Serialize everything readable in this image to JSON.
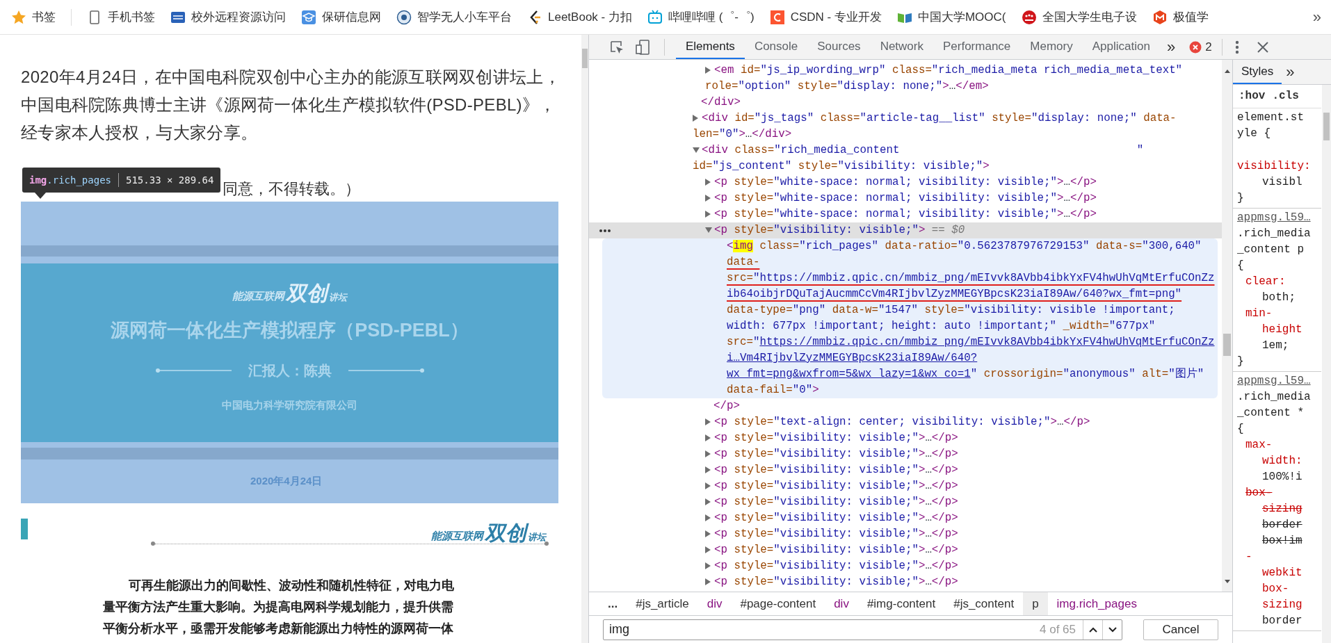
{
  "bookmarks": [
    {
      "kind": "star",
      "label": "书签"
    },
    {
      "kind": "phone",
      "label": "手机书签"
    },
    {
      "kind": "square",
      "label": "校外远程资源访问"
    },
    {
      "kind": "cap",
      "label": "保研信息网"
    },
    {
      "kind": "emblem",
      "label": "智学无人小车平台"
    },
    {
      "kind": "chevron",
      "label": "LeetBook - 力扣"
    },
    {
      "kind": "tv",
      "label": "哔哩哔哩 (゜-゜)"
    },
    {
      "kind": "c",
      "label": "CSDN - 专业开发"
    },
    {
      "kind": "book",
      "label": "中国大学MOOC("
    },
    {
      "kind": "people",
      "label": "全国大学生电子设"
    },
    {
      "kind": "hexagon",
      "label": "极值学"
    }
  ],
  "bookmarks_more": "»",
  "article": {
    "intro": "2020年4月24日，在中国电科院双创中心主办的能源互联网双创讲坛上，中国电科院陈典博士主讲《源网荷一体化生产模拟软件(PSD-PEBL)》，经专家本人授权，与大家分享。",
    "note": "同意，不得转载。）",
    "tooltip": {
      "tag": "img",
      "class": ".rich_pages",
      "size": "515.33 × 289.64"
    },
    "slide": {
      "logo": {
        "left": "能源互联网",
        "big": "双创",
        "right": "讲坛"
      },
      "title": "源网荷一体化生产模拟程序（PSD-PEBL）",
      "presenter": "汇报人：陈典",
      "org": "中国电力科学研究院有限公司",
      "date": "2020年4月24日"
    },
    "section_logo": {
      "left": "能源互联网",
      "big": "双创",
      "right": "讲坛"
    },
    "body": "可再生能源出力的间歇性、波动性和随机性特征，对电力电量平衡方法产生重大影响。为提高电网科学规划能力，提升供需平衡分析水平，亟需开发能够考虑新能源出力特性的源网荷一体"
  },
  "devtools": {
    "tabs": [
      {
        "label": "Elements",
        "selected": true
      },
      {
        "label": "Console",
        "selected": false
      },
      {
        "label": "Sources",
        "selected": false
      },
      {
        "label": "Network",
        "selected": false
      },
      {
        "label": "Performance",
        "selected": false
      },
      {
        "label": "Memory",
        "selected": false
      },
      {
        "label": "Application",
        "selected": false
      }
    ],
    "tabs_more": "»",
    "errors": "2",
    "tree": [
      {
        "children": [
          {
            "expanded": false,
            "selected": false,
            "hovered": false,
            "tokens": [
              {
                "kind": "tag",
                "text": "<em"
              },
              {
                "kind": "attr",
                "text": " id="
              },
              {
                "kind": "value",
                "text": "\"js_ip_wording_wrp\""
              },
              {
                "kind": "attr",
                "text": " class="
              },
              {
                "kind": "value",
                "text": "\"rich_media_meta rich_media_meta_text\""
              },
              {
                "kind": "attr",
                "text": " role="
              },
              {
                "kind": "value",
                "text": "\"option\""
              },
              {
                "kind": "attr",
                "text": " style="
              },
              {
                "kind": "value",
                "text": "\"display: none;\""
              },
              {
                "kind": "tag",
                "text": ">"
              },
              {
                "kind": "text",
                "text": "…"
              },
              {
                "kind": "tag",
                "text": "</em>"
              }
            ]
          }
        ],
        "close": [
          {
            "kind": "tag",
            "text": "</div>"
          }
        ]
      },
      {
        "expanded": false,
        "selected": false,
        "hovered": false,
        "tokens": [
          {
            "kind": "tag",
            "text": "<div"
          },
          {
            "kind": "attr",
            "text": " id="
          },
          {
            "kind": "value",
            "text": "\"js_tags\""
          },
          {
            "kind": "attr",
            "text": " class="
          },
          {
            "kind": "value",
            "text": "\"article-tag__list\""
          },
          {
            "kind": "attr",
            "text": " style="
          },
          {
            "kind": "value",
            "text": "\"display: none;\""
          },
          {
            "kind": "attr",
            "text": " data-len="
          },
          {
            "kind": "value",
            "text": "\"0\""
          },
          {
            "kind": "tag",
            "text": ">"
          },
          {
            "kind": "text",
            "text": "…"
          },
          {
            "kind": "tag",
            "text": "</div>"
          }
        ]
      },
      {
        "expanded": true,
        "selected": false,
        "hovered": false,
        "tokens": [
          {
            "kind": "tag",
            "text": "<div"
          },
          {
            "kind": "attr",
            "text": " class="
          },
          {
            "kind": "value",
            "text": "\"rich_media_content                                    \""
          },
          {
            "kind": "attr",
            "text": " id="
          },
          {
            "kind": "value",
            "text": "\"js_content\""
          },
          {
            "kind": "attr",
            "text": " style="
          },
          {
            "kind": "value",
            "text": "\"visibility: visible;\""
          },
          {
            "kind": "tag",
            "text": ">"
          }
        ],
        "children": [
          {
            "expanded": false,
            "selected": false,
            "hovered": false,
            "tokens": [
              {
                "kind": "tag",
                "text": "<p"
              },
              {
                "kind": "attr",
                "text": " style="
              },
              {
                "kind": "value",
                "text": "\"white-space: normal; visibility: visible;\""
              },
              {
                "kind": "tag",
                "text": ">"
              },
              {
                "kind": "text",
                "text": "…"
              },
              {
                "kind": "tag",
                "text": "</p>"
              }
            ]
          },
          {
            "expanded": false,
            "selected": false,
            "hovered": false,
            "tokens": [
              {
                "kind": "tag",
                "text": "<p"
              },
              {
                "kind": "attr",
                "text": " style="
              },
              {
                "kind": "value",
                "text": "\"white-space: normal; visibility: visible;\""
              },
              {
                "kind": "tag",
                "text": ">"
              },
              {
                "kind": "text",
                "text": "…"
              },
              {
                "kind": "tag",
                "text": "</p>"
              }
            ]
          },
          {
            "expanded": false,
            "selected": false,
            "hovered": false,
            "tokens": [
              {
                "kind": "tag",
                "text": "<p"
              },
              {
                "kind": "attr",
                "text": " style="
              },
              {
                "kind": "value",
                "text": "\"white-space: normal; visibility: visible;\""
              },
              {
                "kind": "tag",
                "text": ">"
              },
              {
                "kind": "text",
                "text": "…"
              },
              {
                "kind": "tag",
                "text": "</p>"
              }
            ]
          },
          {
            "expanded": true,
            "selected": true,
            "hovered": false,
            "tokens": [
              {
                "kind": "tag",
                "text": "<p"
              },
              {
                "kind": "attr",
                "text": " style="
              },
              {
                "kind": "value",
                "text": "\"visibility: visible;\""
              },
              {
                "kind": "tag",
                "text": ">"
              },
              {
                "kind": "ref",
                "text": " == $0"
              }
            ],
            "children": [
              {
                "selected": false,
                "hovered": true,
                "tokens": [
                  {
                    "kind": "tag",
                    "text": "<"
                  },
                  {
                    "kind": "tag",
                    "text": "img",
                    "search_match": true
                  },
                  {
                    "kind": "attr",
                    "text": " class="
                  },
                  {
                    "kind": "value",
                    "text": "\"rich_pages\""
                  },
                  {
                    "kind": "attr",
                    "text": " data-ratio="
                  },
                  {
                    "kind": "value",
                    "text": "\"0.5623787976729153\""
                  },
                  {
                    "kind": "attr",
                    "text": " data-s="
                  },
                  {
                    "kind": "value",
                    "text": "\"300,640\" "
                  },
                  {
                    "kind": "attr",
                    "text": "data-src=",
                    "red_underline": true
                  },
                  {
                    "kind": "value",
                    "text": "\"https://mmbiz.qpic.cn/mmbiz_png/mEIvvk8AVbb4ibkYxFV4hwUhVqMtErfuCOnZzib64oibjrDQuTajAucmmCcVm4RIjbvlZyzMMEGYBpcsK23iaI89Aw/640?wx_fmt=png\"",
                    "red_underline": true
                  },
                  {
                    "kind": "attr",
                    "text": " data-type="
                  },
                  {
                    "kind": "value",
                    "text": "\"png\""
                  },
                  {
                    "kind": "attr",
                    "text": " data-w="
                  },
                  {
                    "kind": "value",
                    "text": "\"1547\""
                  },
                  {
                    "kind": "attr",
                    "text": " style="
                  },
                  {
                    "kind": "value",
                    "text": "\"visibility: visible !important; width: 677px !important; height: auto !important;\""
                  },
                  {
                    "kind": "attr",
                    "text": " _width="
                  },
                  {
                    "kind": "value",
                    "text": "\"677px\""
                  },
                  {
                    "kind": "attr",
                    "text": " src="
                  },
                  {
                    "kind": "value",
                    "text": "\""
                  },
                  {
                    "kind": "link",
                    "text": "https://mmbiz.qpic.cn/mmbiz_png/mEIvvk8AVbb4ibkYxFV4hwUhVqMtErfuCOnZzi…Vm4RIjbvlZyzMMEGYBpcsK23iaI89Aw/640?wx_fmt=png&wxfrom=5&wx_lazy=1&wx_co=1"
                  },
                  {
                    "kind": "value",
                    "text": "\""
                  },
                  {
                    "kind": "attr",
                    "text": " crossorigin="
                  },
                  {
                    "kind": "value",
                    "text": "\"anonymous\""
                  },
                  {
                    "kind": "attr",
                    "text": " alt="
                  },
                  {
                    "kind": "value",
                    "text": "\"图片\""
                  },
                  {
                    "kind": "attr",
                    "text": " data-fail="
                  },
                  {
                    "kind": "value",
                    "text": "\"0\""
                  },
                  {
                    "kind": "tag",
                    "text": ">"
                  }
                ]
              }
            ],
            "close": [
              {
                "kind": "tag",
                "text": "</p>"
              }
            ]
          },
          {
            "expanded": false,
            "selected": false,
            "hovered": false,
            "tokens": [
              {
                "kind": "tag",
                "text": "<p"
              },
              {
                "kind": "attr",
                "text": " style="
              },
              {
                "kind": "value",
                "text": "\"text-align: center; visibility: visible;\""
              },
              {
                "kind": "tag",
                "text": ">"
              },
              {
                "kind": "text",
                "text": "…"
              },
              {
                "kind": "tag",
                "text": "</p>"
              }
            ]
          },
          {
            "expanded": false,
            "selected": false,
            "hovered": false,
            "tokens": [
              {
                "kind": "tag",
                "text": "<p"
              },
              {
                "kind": "attr",
                "text": " style="
              },
              {
                "kind": "value",
                "text": "\"visibility: visible;\""
              },
              {
                "kind": "tag",
                "text": ">"
              },
              {
                "kind": "text",
                "text": "…"
              },
              {
                "kind": "tag",
                "text": "</p>"
              }
            ]
          },
          {
            "expanded": false,
            "selected": false,
            "hovered": false,
            "tokens": [
              {
                "kind": "tag",
                "text": "<p"
              },
              {
                "kind": "attr",
                "text": " style="
              },
              {
                "kind": "value",
                "text": "\"visibility: visible;\""
              },
              {
                "kind": "tag",
                "text": ">"
              },
              {
                "kind": "text",
                "text": "…"
              },
              {
                "kind": "tag",
                "text": "</p>"
              }
            ]
          },
          {
            "expanded": false,
            "selected": false,
            "hovered": false,
            "tokens": [
              {
                "kind": "tag",
                "text": "<p"
              },
              {
                "kind": "attr",
                "text": " style="
              },
              {
                "kind": "value",
                "text": "\"visibility: visible;\""
              },
              {
                "kind": "tag",
                "text": ">"
              },
              {
                "kind": "text",
                "text": "…"
              },
              {
                "kind": "tag",
                "text": "</p>"
              }
            ]
          },
          {
            "expanded": false,
            "selected": false,
            "hovered": false,
            "tokens": [
              {
                "kind": "tag",
                "text": "<p"
              },
              {
                "kind": "attr",
                "text": " style="
              },
              {
                "kind": "value",
                "text": "\"visibility: visible;\""
              },
              {
                "kind": "tag",
                "text": ">"
              },
              {
                "kind": "text",
                "text": "…"
              },
              {
                "kind": "tag",
                "text": "</p>"
              }
            ]
          },
          {
            "expanded": false,
            "selected": false,
            "hovered": false,
            "tokens": [
              {
                "kind": "tag",
                "text": "<p"
              },
              {
                "kind": "attr",
                "text": " style="
              },
              {
                "kind": "value",
                "text": "\"visibility: visible;\""
              },
              {
                "kind": "tag",
                "text": ">"
              },
              {
                "kind": "text",
                "text": "…"
              },
              {
                "kind": "tag",
                "text": "</p>"
              }
            ]
          },
          {
            "expanded": false,
            "selected": false,
            "hovered": false,
            "tokens": [
              {
                "kind": "tag",
                "text": "<p"
              },
              {
                "kind": "attr",
                "text": " style="
              },
              {
                "kind": "value",
                "text": "\"visibility: visible;\""
              },
              {
                "kind": "tag",
                "text": ">"
              },
              {
                "kind": "text",
                "text": "…"
              },
              {
                "kind": "tag",
                "text": "</p>"
              }
            ]
          },
          {
            "expanded": false,
            "selected": false,
            "hovered": false,
            "tokens": [
              {
                "kind": "tag",
                "text": "<p"
              },
              {
                "kind": "attr",
                "text": " style="
              },
              {
                "kind": "value",
                "text": "\"visibility: visible;\""
              },
              {
                "kind": "tag",
                "text": ">"
              },
              {
                "kind": "text",
                "text": "…"
              },
              {
                "kind": "tag",
                "text": "</p>"
              }
            ]
          },
          {
            "expanded": false,
            "selected": false,
            "hovered": false,
            "tokens": [
              {
                "kind": "tag",
                "text": "<p"
              },
              {
                "kind": "attr",
                "text": " style="
              },
              {
                "kind": "value",
                "text": "\"visibility: visible;\""
              },
              {
                "kind": "tag",
                "text": ">"
              },
              {
                "kind": "text",
                "text": "…"
              },
              {
                "kind": "tag",
                "text": "</p>"
              }
            ]
          },
          {
            "expanded": false,
            "selected": false,
            "hovered": false,
            "tokens": [
              {
                "kind": "tag",
                "text": "<p"
              },
              {
                "kind": "attr",
                "text": " style="
              },
              {
                "kind": "value",
                "text": "\"visibility: visible;\""
              },
              {
                "kind": "tag",
                "text": ">"
              },
              {
                "kind": "text",
                "text": "…"
              },
              {
                "kind": "tag",
                "text": "</p>"
              }
            ]
          },
          {
            "expanded": false,
            "selected": false,
            "hovered": false,
            "tokens": [
              {
                "kind": "tag",
                "text": "<p"
              },
              {
                "kind": "attr",
                "text": " style="
              },
              {
                "kind": "value",
                "text": "\"visibility: visible;\""
              },
              {
                "kind": "tag",
                "text": ">"
              },
              {
                "kind": "text",
                "text": "…"
              },
              {
                "kind": "tag",
                "text": "</p>"
              }
            ]
          }
        ]
      }
    ],
    "breadcrumb": [
      {
        "kind": "more",
        "text": "...",
        "selected": false
      },
      {
        "kind": "id",
        "text": "#js_article",
        "selected": false
      },
      {
        "kind": "tag",
        "text": "div",
        "selected": false
      },
      {
        "kind": "id",
        "text": "#page-content",
        "selected": false
      },
      {
        "kind": "tag",
        "text": "div",
        "selected": false
      },
      {
        "kind": "id",
        "text": "#img-content",
        "selected": false
      },
      {
        "kind": "id",
        "text": "#js_content",
        "selected": false
      },
      {
        "kind": "id",
        "text": "p",
        "selected": true
      },
      {
        "kind": "tag",
        "text": "img.rich_pages",
        "selected": false
      }
    ],
    "search": {
      "value": "img",
      "count": "4 of 65",
      "cancel": "Cancel"
    },
    "styles": {
      "tabs": [
        {
          "label": "Styles",
          "selected": true
        }
      ],
      "tabs_more": "»",
      "filters": [
        ":hov",
        ".cls"
      ],
      "rules": [
        {
          "lines": [
            {
              "kind": "selector",
              "text": "element.st"
            },
            {
              "kind": "selector",
              "text": "yle {"
            },
            {
              "kind": "prop_flush",
              "text": "visibility:",
              "struck": false
            },
            {
              "kind": "value",
              "text": "visibl",
              "struck": false
            },
            {
              "kind": "brace",
              "text": "}"
            }
          ]
        },
        {
          "lines": [
            {
              "kind": "source",
              "text": "appmsg.l59…"
            },
            {
              "kind": "selector",
              "text": ".rich_media"
            },
            {
              "kind": "selector",
              "text": "_content p"
            },
            {
              "kind": "brace",
              "text": "{"
            },
            {
              "kind": "prop",
              "text": "clear:",
              "struck": false
            },
            {
              "kind": "value",
              "text": "both;",
              "struck": false
            },
            {
              "kind": "prop",
              "text": "min-",
              "struck": false
            },
            {
              "kind": "prop_wrap",
              "text": "height",
              "struck": false
            },
            {
              "kind": "value",
              "text": "1em;",
              "struck": false
            },
            {
              "kind": "brace",
              "text": "}"
            }
          ]
        },
        {
          "lines": [
            {
              "kind": "source",
              "text": "appmsg.l59…"
            },
            {
              "kind": "selector",
              "text": ".rich_media"
            },
            {
              "kind": "selector",
              "text": "_content *"
            },
            {
              "kind": "brace",
              "text": "{"
            },
            {
              "kind": "prop",
              "text": "max-",
              "struck": false
            },
            {
              "kind": "prop_wrap",
              "text": "width:",
              "struck": false
            },
            {
              "kind": "value",
              "text": "100%!i",
              "struck": false
            },
            {
              "kind": "prop",
              "text": "box-",
              "struck": true
            },
            {
              "kind": "prop_wrap",
              "text": "sizing",
              "struck": true
            },
            {
              "kind": "value",
              "text": "border",
              "struck": true
            },
            {
              "kind": "value",
              "text": "box!im",
              "struck": true
            },
            {
              "kind": "prop",
              "text": "-",
              "struck": false
            },
            {
              "kind": "prop_wrap",
              "text": "webkit",
              "struck": false
            },
            {
              "kind": "prop_wrap",
              "text": "box-",
              "struck": false
            },
            {
              "kind": "prop_wrap",
              "text": "sizing",
              "struck": false
            },
            {
              "kind": "value",
              "text": "border",
              "struck": false
            }
          ]
        }
      ]
    }
  }
}
